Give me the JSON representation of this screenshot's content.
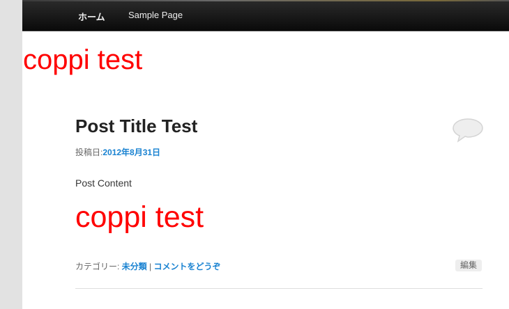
{
  "nav": {
    "home_label": "ホーム",
    "sample_label": "Sample Page"
  },
  "site": {
    "test_text": "coppi test"
  },
  "post": {
    "title": "Post Title Test",
    "date_prefix": "投稿日:",
    "date": "2012年8月31日",
    "content": "Post Content",
    "content_test": "coppi test",
    "category_prefix": "カテゴリー: ",
    "category": "未分類",
    "separator": " | ",
    "comment_link": "コメントをどうぞ",
    "edit_label": "編集"
  },
  "colors": {
    "link": "#1982d1",
    "red_text": "#ff0000",
    "nav_bg": "#0a0a0a"
  }
}
